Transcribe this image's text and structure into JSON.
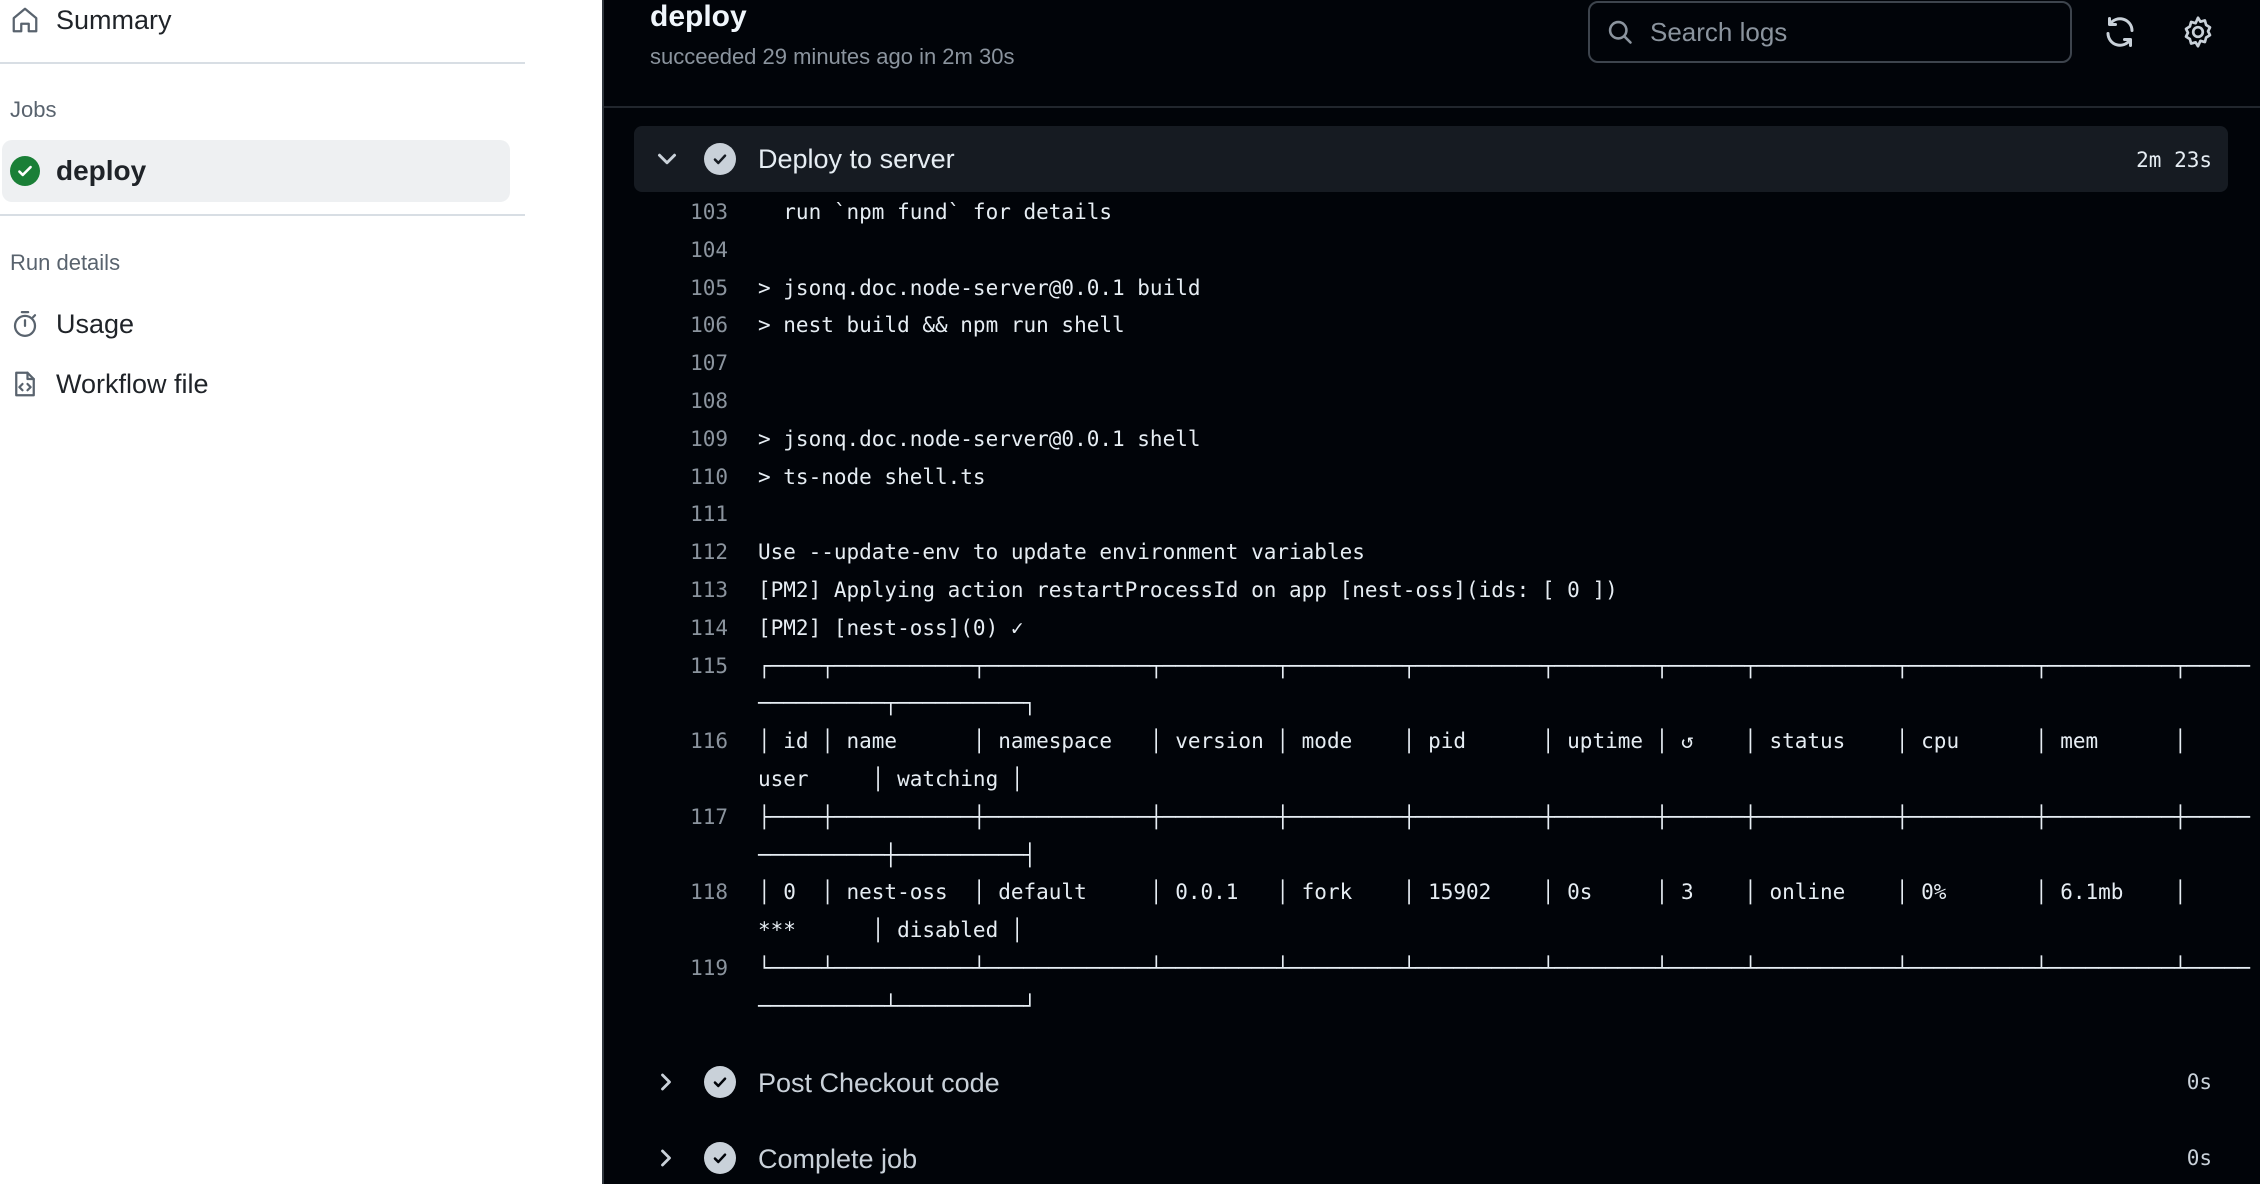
{
  "sidebar": {
    "summary_label": "Summary",
    "jobs_heading": "Jobs",
    "job_label": "deploy",
    "run_details_heading": "Run details",
    "usage_label": "Usage",
    "workflow_label": "Workflow file"
  },
  "header": {
    "title": "deploy",
    "subtitle": "succeeded 29 minutes ago in 2m 30s",
    "search_placeholder": "Search logs"
  },
  "step": {
    "name": "Deploy to server",
    "duration": "2m 23s"
  },
  "log_lines": [
    {
      "n": "103",
      "t": "  run `npm fund` for details"
    },
    {
      "n": "104",
      "t": ""
    },
    {
      "n": "105",
      "t": "> jsonq.doc.node-server@0.0.1 build"
    },
    {
      "n": "106",
      "t": "> nest build && npm run shell"
    },
    {
      "n": "107",
      "t": ""
    },
    {
      "n": "108",
      "t": ""
    },
    {
      "n": "109",
      "t": "> jsonq.doc.node-server@0.0.1 shell"
    },
    {
      "n": "110",
      "t": "> ts-node shell.ts"
    },
    {
      "n": "111",
      "t": ""
    },
    {
      "n": "112",
      "t": "Use --update-env to update environment variables"
    },
    {
      "n": "113",
      "t": "[PM2] Applying action restartProcessId on app [nest-oss](ids: [ 0 ])"
    },
    {
      "n": "114",
      "t": "[PM2] [nest-oss](0) ✓"
    },
    {
      "n": "115",
      "t": "┌────┬───────────┬─────────────┬─────────┬─────────┬──────────┬────────┬──────┬───────────┬──────────┬──────────┬─────"
    },
    {
      "n": "",
      "t": "──────────┬──────────┐"
    },
    {
      "n": "116",
      "t": "│ id │ name      │ namespace   │ version │ mode    │ pid      │ uptime │ ↺    │ status    │ cpu      │ mem      │"
    },
    {
      "n": "",
      "t": "user     │ watching │"
    },
    {
      "n": "117",
      "t": "├────┼───────────┼─────────────┼─────────┼─────────┼──────────┼────────┼──────┼───────────┼──────────┼──────────┼─────"
    },
    {
      "n": "",
      "t": "──────────┼──────────┤"
    },
    {
      "n": "118",
      "t": "│ 0  │ nest-oss  │ default     │ 0.0.1   │ fork    │ 15902    │ 0s     │ 3    │ online    │ 0%       │ 6.1mb    │"
    },
    {
      "n": "",
      "t": "***      │ disabled │"
    },
    {
      "n": "119",
      "t": "└────┴───────────┴─────────────┴─────────┴─────────┴──────────┴────────┴──────┴───────────┴──────────┴──────────┴─────"
    },
    {
      "n": "",
      "t": "──────────┴──────────┘"
    }
  ],
  "collapsed_steps": [
    {
      "name": "Post Checkout code",
      "duration": "0s"
    },
    {
      "name": "Complete job",
      "duration": "0s"
    }
  ],
  "colors": {
    "success_green": "#1a7f37",
    "dark_bg": "#010409",
    "step_bg": "#161b22"
  },
  "icons": {
    "summary": "home-icon",
    "job_status": "check-circle-icon",
    "usage": "stopwatch-icon",
    "workflow": "workflow-file-icon",
    "search": "search-icon",
    "refresh": "refresh-icon",
    "settings": "gear-icon",
    "expand": "chevron-down-icon",
    "collapse": "chevron-right-icon"
  }
}
